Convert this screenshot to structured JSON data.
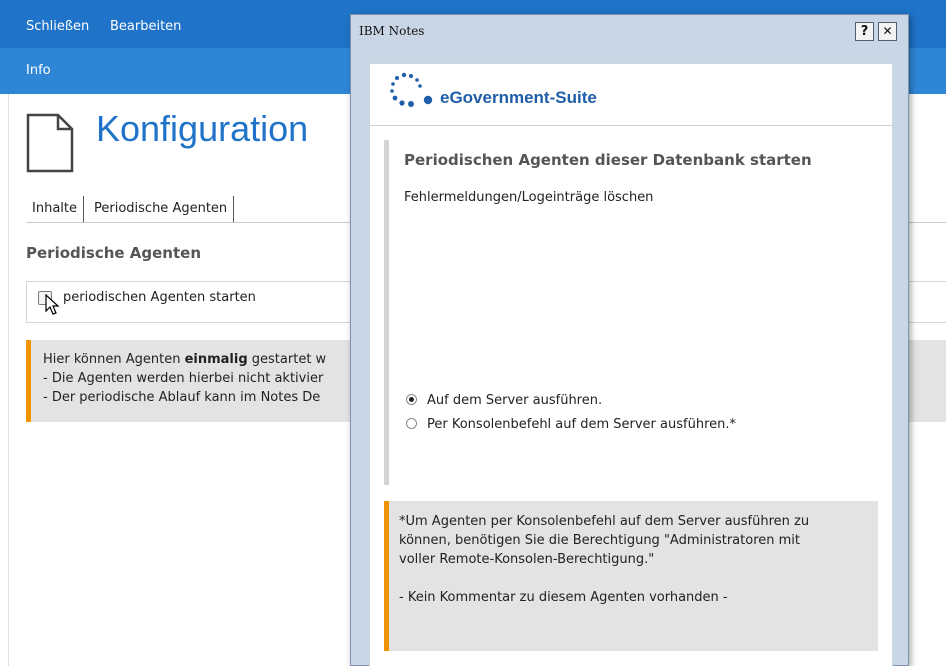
{
  "menu": {
    "items": [
      "Schließen",
      "Bearbeiten"
    ],
    "sub_item": "Info"
  },
  "page": {
    "title": "Konfiguration",
    "tabs": [
      "Inhalte",
      "Periodische Agenten"
    ],
    "section_heading": "Periodische Agenten",
    "checkbox_label": "periodischen Agenten starten",
    "info": {
      "line1_prefix": "Hier können Agenten ",
      "line1_bold": "einmalig",
      "line1_suffix": " gestartet w",
      "line2": "- Die Agenten werden hierbei nicht aktivier",
      "line3": "- Der periodische Ablauf kann im Notes De"
    }
  },
  "dialog": {
    "title": "IBM Notes",
    "help_label": "?",
    "close_label": "✕",
    "logo_text": "eGovernment-Suite",
    "heading": "Periodischen Agenten dieser Datenbank starten",
    "text": "Fehlermeldungen/Logeinträge löschen",
    "radio_options": [
      {
        "label": "Auf dem Server ausführen.",
        "selected": true
      },
      {
        "label": "Per Konsolenbefehl auf dem Server ausführen.*",
        "selected": false
      }
    ],
    "note": {
      "line1": "*Um Agenten per Konsolenbefehl auf dem Server ausführen zu",
      "line2": "können, benötigen Sie die Berechtigung \"Administratoren mit",
      "line3": "voller Remote-Konsolen-Berechtigung.\"",
      "line4": "- Kein Kommentar zu diesem Agenten vorhanden -"
    }
  },
  "colors": {
    "accent_blue": "#1f73c8",
    "menubar_blue": "#2f86d7",
    "warning_orange": "#f29400",
    "info_gray": "#e3e3e3"
  }
}
